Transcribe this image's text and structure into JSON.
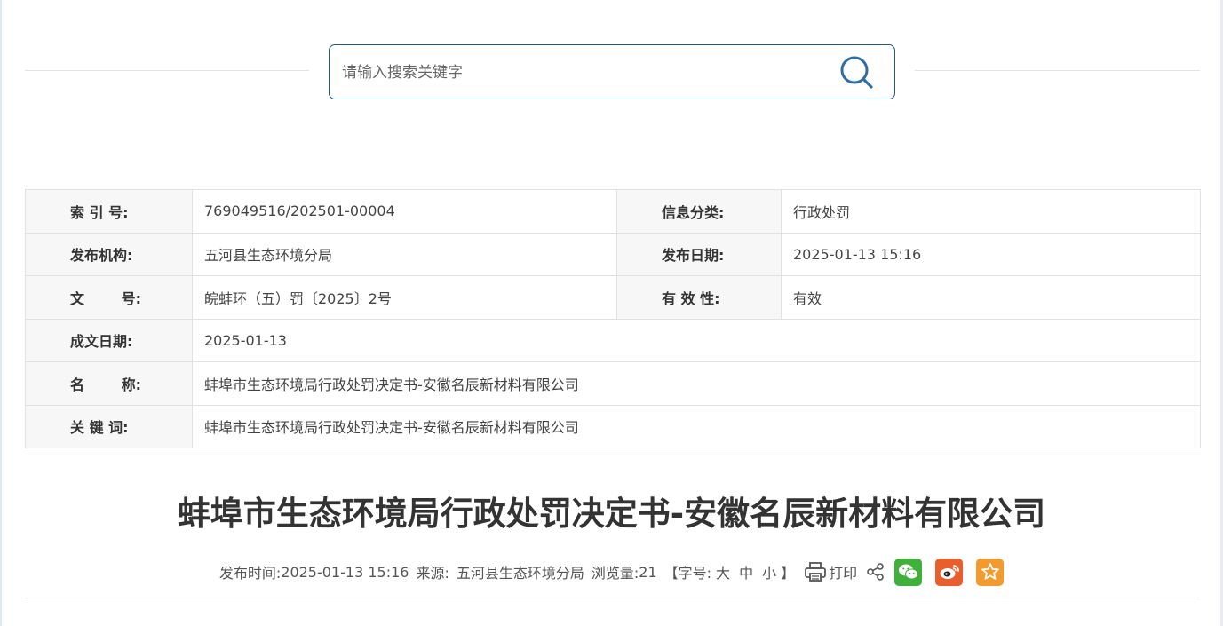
{
  "search": {
    "placeholder": "请输入搜索关键字"
  },
  "info": {
    "rows": [
      {
        "l1": "索 引 号:",
        "v1": "769049516/202501-00004",
        "l2": "信息分类:",
        "v2": "行政处罚"
      },
      {
        "l1": "发布机构:",
        "v1": "五河县生态环境分局",
        "l2": "发布日期:",
        "v2": "2025-01-13 15:16"
      },
      {
        "l1": "文 号:",
        "v1": "皖蚌环（五）罚〔2025〕2号",
        "l2": "有 效 性:",
        "v2": "有效"
      },
      {
        "l1": "成文日期:",
        "v1": "2025-01-13"
      },
      {
        "l1": "名 称:",
        "v1": "蚌埠市生态环境局行政处罚决定书-安徽名辰新材料有限公司"
      },
      {
        "l1": "关 键 词:",
        "v1": "蚌埠市生态环境局行政处罚决定书-安徽名辰新材料有限公司"
      }
    ]
  },
  "article": {
    "title": "蚌埠市生态环境局行政处罚决定书-安徽名辰新材料有限公司",
    "publish_time_label": "发布时间:",
    "publish_time": "2025-01-13 15:16",
    "source_label": "来源:",
    "source": "五河县生态环境分局",
    "views_label": "浏览量:",
    "views": "21",
    "font_size_open": "【字号:",
    "font_large": "大",
    "font_medium": "中",
    "font_small": "小",
    "font_size_close": "】",
    "print_label": "打印"
  },
  "icons": {
    "search": "search-icon",
    "print": "printer-icon",
    "share": "share-icon",
    "wechat": "wechat-icon",
    "weibo": "weibo-icon",
    "favorite": "star-icon"
  },
  "colors": {
    "accent": "#1f5b8f",
    "wechat": "#3fb03a",
    "weibo": "#ea5d2c",
    "favorite": "#f29a2e"
  }
}
